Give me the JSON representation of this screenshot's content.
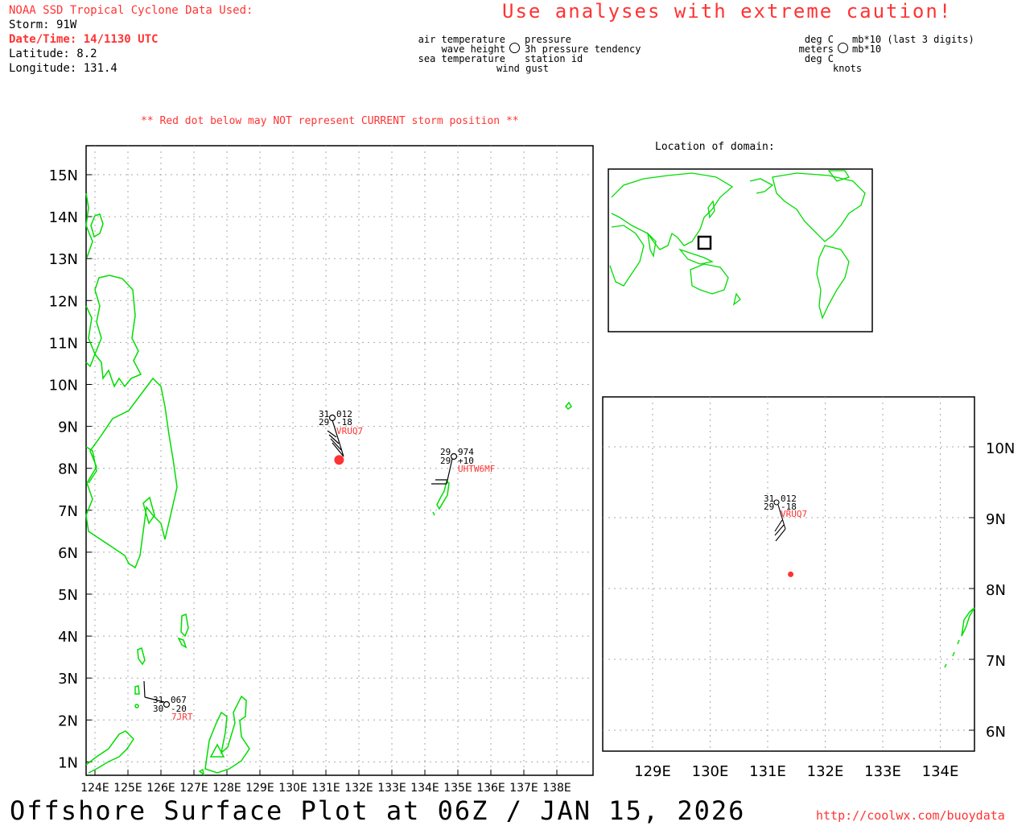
{
  "header": {
    "source": "NOAA SSD Tropical Cyclone Data Used:",
    "storm": "Storm: 91W",
    "datetime": "Date/Time: 14/1130 UTC",
    "latitude": "Latitude: 8.2",
    "longitude": "Longitude: 131.4"
  },
  "caution": "Use analyses with extreme caution!",
  "legend_left": {
    "air_temperature": "air temperature",
    "pressure": "pressure",
    "wave_height": "wave height",
    "pressure_tendency": "3h pressure tendency",
    "sea_temperature": "sea temperature",
    "station_id": "station id",
    "wind_gust": "wind gust"
  },
  "legend_right": {
    "deg_c_1": "deg C",
    "mb": "mb*10 (last 3 digits)",
    "meters": "meters",
    "mb_tend": "mb*10",
    "deg_c_2": "deg C",
    "knots": "knots"
  },
  "red_dot_note": "** Red dot below may NOT represent CURRENT storm position **",
  "location_label": "Location of domain:",
  "main_map": {
    "lat_labels": [
      "15N",
      "14N",
      "13N",
      "12N",
      "11N",
      "10N",
      "9N",
      "8N",
      "7N",
      "6N",
      "5N",
      "4N",
      "3N",
      "2N",
      "1N"
    ],
    "lon_labels": [
      "124E",
      "125E",
      "126E",
      "127E",
      "128E",
      "129E",
      "130E",
      "131E",
      "132E",
      "133E",
      "134E",
      "135E",
      "136E",
      "137E",
      "138E"
    ],
    "storm_position": {
      "lat": 8.2,
      "lon": 131.4
    },
    "stations": [
      {
        "id": "VRUQ7",
        "air_temp": "31",
        "sea_temp": "29",
        "pressure": "012",
        "tendency": "-18"
      },
      {
        "id": "UHTW6MF",
        "air_temp": "29",
        "sea_temp": "29",
        "pressure": "974",
        "tendency": "+10"
      },
      {
        "id": "7JRT",
        "air_temp": "31",
        "sea_temp": "30",
        "pressure": "067",
        "tendency": "-20"
      }
    ]
  },
  "zoom_map": {
    "lat_labels": [
      "10N",
      "9N",
      "8N",
      "7N",
      "6N"
    ],
    "lon_labels": [
      "129E",
      "130E",
      "131E",
      "132E",
      "133E",
      "134E"
    ],
    "station": {
      "id": "VRUQ7",
      "air_temp": "31",
      "sea_temp": "29",
      "pressure": "012",
      "tendency": "-18"
    }
  },
  "footer": {
    "title": "Offshore Surface Plot at 06Z / JAN 15, 2026",
    "url": "http://coolwx.com/buoydata"
  },
  "colors": {
    "land": "#00dd00",
    "accent": "#ff3333",
    "grid": "#aaaaaa"
  }
}
